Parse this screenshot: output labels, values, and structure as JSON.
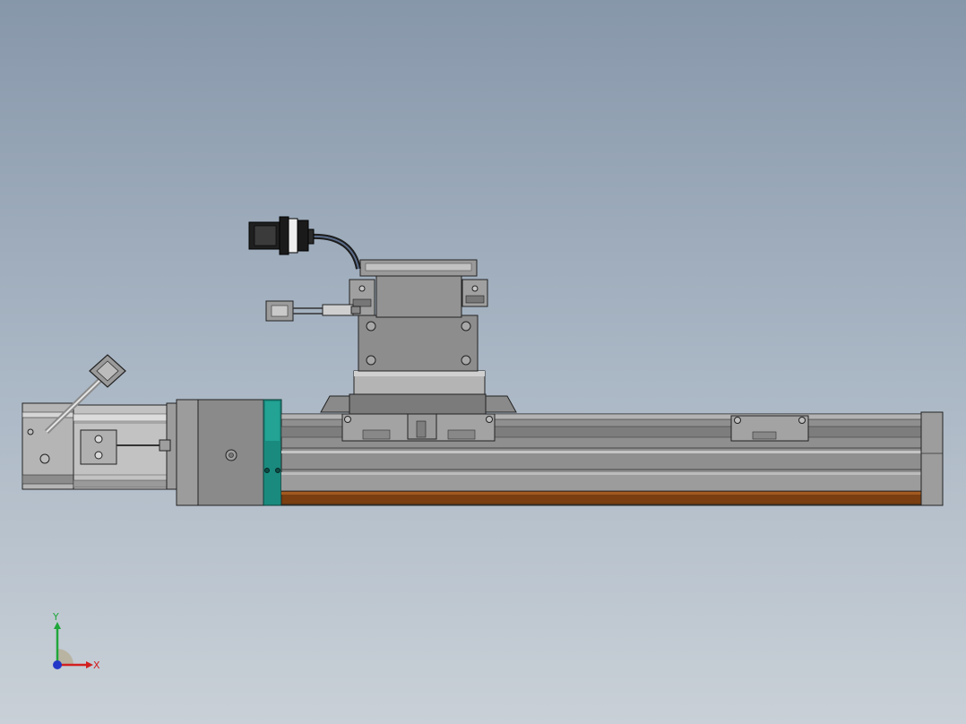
{
  "viewport": {
    "background_top": "#8797aa",
    "background_bottom": "#c9d0d7"
  },
  "triad": {
    "x_label": "X",
    "y_label": "Y",
    "x_color": "#d22020",
    "y_color": "#1fa63a",
    "z_color": "#2436c8"
  },
  "model": {
    "body_color": "#8f8f8f",
    "coupling_color": "#1a8a7e",
    "cover_strip_color": "#7a3e10",
    "motor_color": "#a6a6a6"
  }
}
